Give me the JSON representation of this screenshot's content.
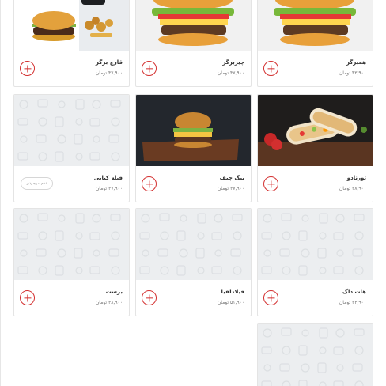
{
  "currency": "تومان",
  "unavailable_label": "عدم موجودی",
  "colors": {
    "accent": "#d32f2f",
    "border": "#e4e4e4",
    "placeholder": "#eceef0"
  },
  "products": [
    {
      "name": "قارچ برگر",
      "price": "۴۷,۹۰۰",
      "image": "burger-fries",
      "available": true
    },
    {
      "name": "چیزبرگر",
      "price": "۴۷,۹۰۰",
      "image": "cheeseburger",
      "available": true
    },
    {
      "name": "همبرگر",
      "price": "۴۳,۹۰۰",
      "image": "cheeseburger",
      "available": true
    },
    {
      "name": "فیله کبابی",
      "price": "۴۷,۹۰۰",
      "image": "placeholder",
      "available": false
    },
    {
      "name": "بیگ چیف",
      "price": "۴۷,۹۰۰",
      "image": "burger-dark",
      "available": true
    },
    {
      "name": "تورنادو",
      "price": "۳۸,۹۰۰",
      "image": "wrap",
      "available": true
    },
    {
      "name": "برست",
      "price": "۳۸,۹۰۰",
      "image": "placeholder",
      "available": true
    },
    {
      "name": "فیلادلفیا",
      "price": "۵۱,۹۰۰",
      "image": "placeholder",
      "available": true
    },
    {
      "name": "هات داگ",
      "price": "۳۴,۹۰۰",
      "image": "placeholder",
      "available": true
    },
    {
      "name": "",
      "price": "",
      "image": "placeholder",
      "available": true
    }
  ]
}
